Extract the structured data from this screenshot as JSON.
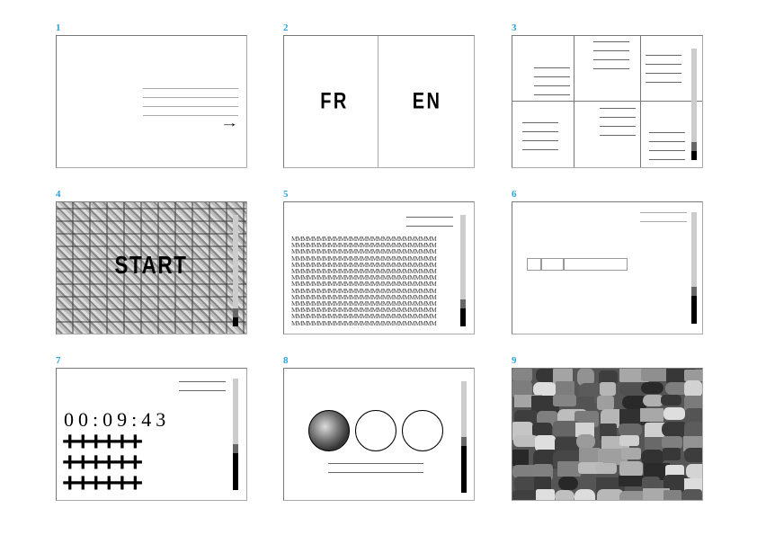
{
  "panels": [
    {
      "number": "1",
      "arrow": "→"
    },
    {
      "number": "2",
      "left_label": "FR",
      "right_label": "EN"
    },
    {
      "number": "3",
      "scroll_level": 0.08
    },
    {
      "number": "4",
      "title": "START",
      "scroll_level": 0.08
    },
    {
      "number": "5",
      "text_lines": [
        "MMMMMMMMMMMMMMMMMMMMMMMMMMM",
        "MMMMMMMMMMMMMMMMMMMMMMMMMMM",
        "MMMMMMMMMMMMMMMMMMMMMMMMMMM",
        "MMMMMMMMMMMMMMMMMMMMMMMMMMM",
        "MMMMMMMMMMMMMMMMMMMMMMMMMMM",
        "MMMMMMMMMMMMMMMMMMMMMMMMMMM",
        "MMMMMMMMMMMMMMMMMMMMMMMMMMM",
        "MMMMMMMMMMMMMMMMMMMMMMMMMMM",
        "MMMMMMMMMMMMMMMMMMMMMMMMMMM",
        "MMMMMMMMMMMMMMMMMMMMMMMMMMM",
        "MMMMMMMMMMMMMMMMMMMMMMMMMMM",
        "MMMMMMMMMMMMMMMMMMMMMMMMMMM",
        "MMMMMMMMMMMMMMMMMMMMMMMMMMM",
        "MMMMMMMMMMMMMMMMMMMMMMMMMMM"
      ],
      "scroll_level": 0.16
    },
    {
      "number": "6",
      "scroll_level": 0.25
    },
    {
      "number": "7",
      "timer": "00:09:43",
      "plus_row": "++++++",
      "scroll_level": 0.33
    },
    {
      "number": "8",
      "scroll_level": 0.42
    },
    {
      "number": "9"
    }
  ],
  "colors": {
    "number": "#29a3dd",
    "scroll_track": "#cccccc",
    "scroll_mid": "#666666",
    "scroll_fill": "#000000"
  }
}
